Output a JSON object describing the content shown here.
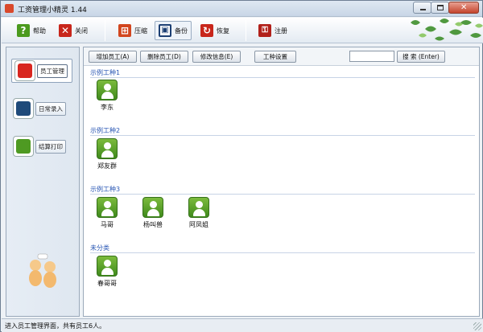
{
  "window": {
    "title": "工资管理小精灵 1.44",
    "controls": [
      "minimize",
      "maximize",
      "close"
    ]
  },
  "toolbar": {
    "items": [
      {
        "label": "帮助",
        "icon": "help-icon",
        "color": "#4b9a1e",
        "glyph": "?"
      },
      {
        "label": "关闭",
        "icon": "close-icon",
        "color": "#c8261b",
        "glyph": "✕"
      },
      {
        "label": "压缩",
        "icon": "compress-icon",
        "color": "#d2461f",
        "glyph": "⊞"
      },
      {
        "label": "备份",
        "icon": "backup-icon",
        "color": "#1c3f73",
        "glyph": "▣"
      },
      {
        "label": "恢复",
        "icon": "restore-icon",
        "color": "#c8261b",
        "glyph": "↻"
      },
      {
        "label": "注册",
        "icon": "key-icon",
        "color": "#b1201a",
        "glyph": "⚿"
      }
    ]
  },
  "sidebar": {
    "items": [
      {
        "label": "员工管理",
        "icon": "user-icon",
        "color": "#d8261f",
        "selected": true
      },
      {
        "label": "日常录入",
        "icon": "pen-icon",
        "color": "#1f4a7a",
        "selected": false
      },
      {
        "label": "结算打印",
        "icon": "printer-icon",
        "color": "#4e9a22",
        "selected": false
      }
    ]
  },
  "actions": {
    "add": "增加员工(A)",
    "delete": "删除员工(D)",
    "edit": "修改信息(E)",
    "settings": "工种设置",
    "search_value": "",
    "search_button": "搜 索 (Enter)"
  },
  "groups": [
    {
      "name": "示例工种1",
      "employees": [
        "李东"
      ]
    },
    {
      "name": "示例工种2",
      "employees": [
        "郑友群"
      ]
    },
    {
      "name": "示例工种3",
      "employees": [
        "马哥",
        "杨叫兽",
        "阿凤姐"
      ]
    },
    {
      "name": "未分类",
      "employees": [
        "春哥哥"
      ]
    }
  ],
  "status": {
    "text": "进入员工管理界面，共有员工6人。"
  },
  "colors": {
    "accent_blue": "#2a57b4",
    "employee_green": "#4e9a22"
  }
}
